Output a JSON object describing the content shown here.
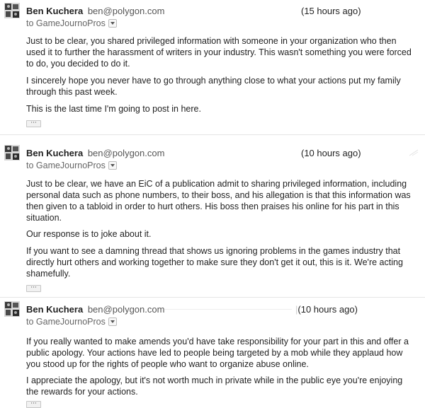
{
  "messages": [
    {
      "sender_name": "Ben Kuchera",
      "sender_email": "ben@polygon.com",
      "time": "(15 hours ago)",
      "recipient": "to GameJournoPros",
      "paragraphs": [
        "Just to be clear, you shared privileged information with someone in your organization who then used it to further the harassment of writers in your industry. This wasn't something you were forced to do, you decided to do it.",
        "I sincerely hope you never have to go through anything close to what your actions put my family through this past week.",
        "This is the last time I'm going to post in here."
      ],
      "more_label": "···"
    },
    {
      "sender_name": "Ben Kuchera",
      "sender_email": "ben@polygon.com",
      "time": "(10 hours ago)",
      "recipient": "to GameJournoPros",
      "paragraphs": [
        "Just to be clear, we have an EiC of a publication admit to sharing privileged information, including personal data such as phone numbers, to their boss, and his allegation is that this information was then given to a tabloid in order to hurt others. His boss then praises his online for his part in this situation.",
        "Our response is to joke about it.",
        "If you want to see a damning thread that shows us ignoring problems in the games industry that directly hurt others and working together to make sure they don't get it out, this is it. We're acting shamefully."
      ],
      "more_label": "···"
    },
    {
      "sender_name": "Ben Kuchera",
      "sender_email": "ben@polygon.com",
      "time": "(10 hours ago)",
      "recipient": "to GameJournoPros",
      "paragraphs": [
        "If you really wanted to make amends you'd have take responsibility for your part in this and offer a public apology. Your actions have led to people being targeted by a mob while they applaud how you stood up for the rights of people who want to organize abuse online.",
        "I appreciate the apology, but it's not worth much in private while in the public eye you're enjoying the rewards for your actions."
      ],
      "more_label": "···"
    }
  ]
}
